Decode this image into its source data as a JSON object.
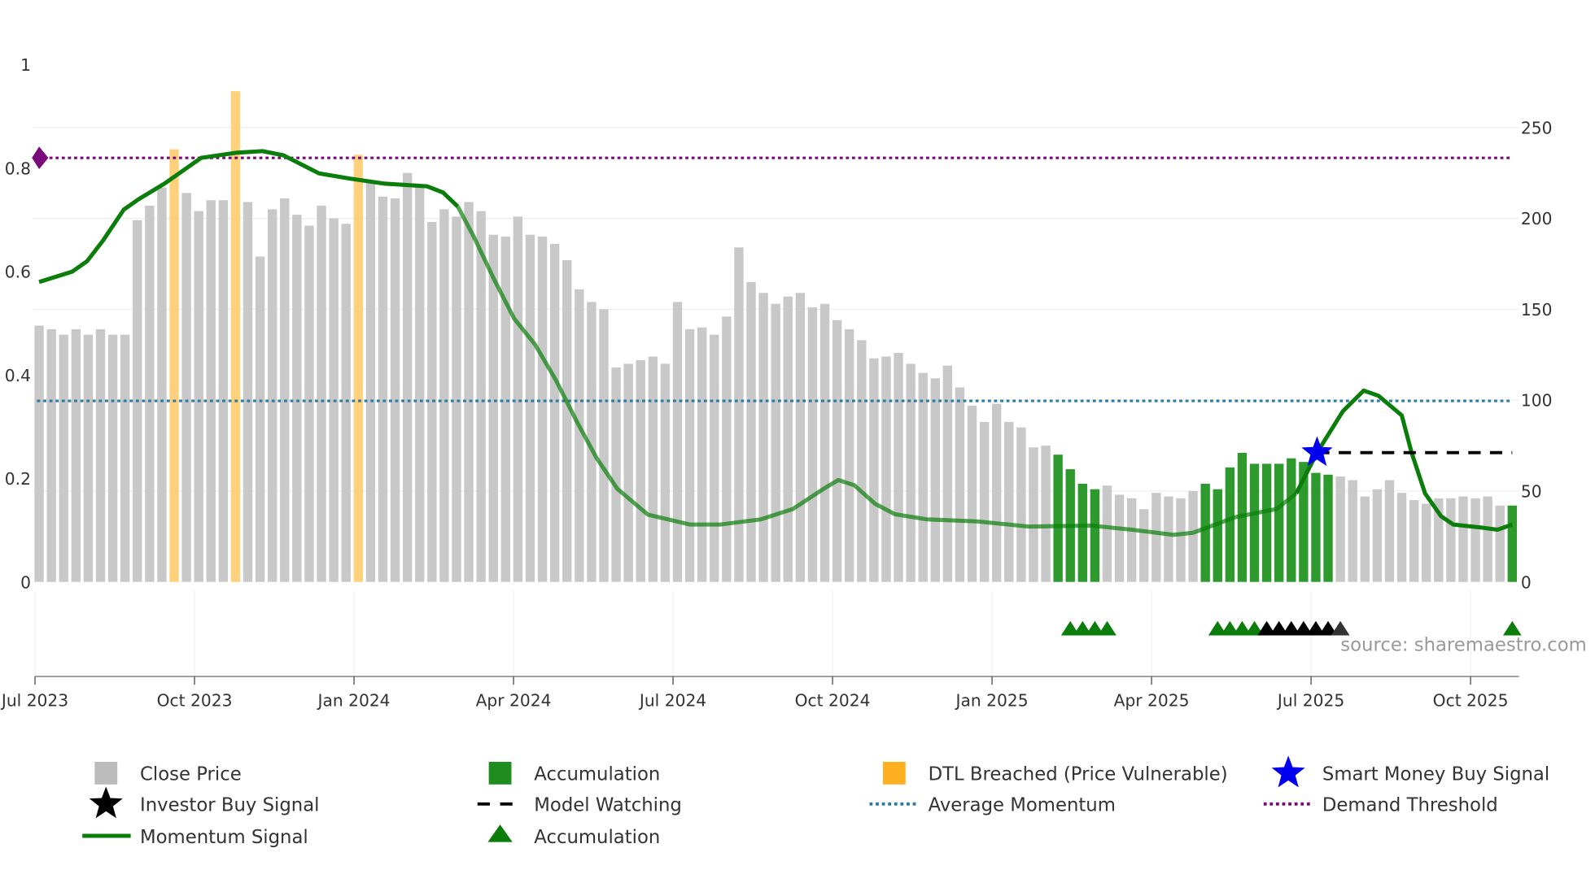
{
  "chart_data": {
    "type": "bar",
    "title": "",
    "x_unit": "weekly bars starting Jul 2023",
    "left_axis": {
      "range": [
        0,
        1
      ],
      "ticks": [
        "0",
        "0.2",
        "0.4",
        "0.6",
        "0.8",
        "1"
      ],
      "tick_values": [
        0,
        0.2,
        0.4,
        0.6,
        0.8,
        1
      ]
    },
    "right_axis": {
      "range": [
        0,
        284
      ],
      "ticks": [
        "0",
        "50",
        "100",
        "150",
        "200",
        "250"
      ],
      "tick_values": [
        0,
        50,
        100,
        150,
        200,
        250
      ]
    },
    "x_ticks": [
      {
        "label": "Jul 2023",
        "month": 0
      },
      {
        "label": "Oct 2023",
        "month": 3
      },
      {
        "label": "Jan 2024",
        "month": 6
      },
      {
        "label": "Apr 2024",
        "month": 9
      },
      {
        "label": "Jul 2024",
        "month": 12
      },
      {
        "label": "Oct 2024",
        "month": 15
      },
      {
        "label": "Jan 2025",
        "month": 18
      },
      {
        "label": "Apr 2025",
        "month": 21
      },
      {
        "label": "Jul 2025",
        "month": 24
      },
      {
        "label": "Oct 2025",
        "month": 27
      }
    ],
    "close_price": [
      141,
      139,
      136,
      139,
      136,
      139,
      136,
      136,
      199,
      207,
      217,
      238,
      214,
      204,
      210,
      210,
      270,
      209,
      179,
      205,
      211,
      202,
      196,
      207,
      200,
      197,
      235,
      221,
      212,
      211,
      225,
      217,
      198,
      205,
      201,
      209,
      204,
      191,
      190,
      201,
      191,
      190,
      186,
      177,
      161,
      154,
      150,
      118,
      120,
      122,
      124,
      120,
      154,
      139,
      140,
      136,
      146,
      184,
      165,
      159,
      153,
      157,
      159,
      151,
      153,
      144,
      139,
      133,
      123,
      124,
      126,
      120,
      115,
      112,
      119,
      107,
      97,
      88,
      98,
      88,
      85,
      74,
      75,
      70,
      62,
      54,
      51,
      53,
      48,
      46,
      40,
      49,
      47,
      46,
      50,
      54,
      51,
      63,
      71,
      65,
      65,
      65,
      68,
      66,
      60,
      59,
      58,
      56,
      47,
      51,
      56,
      49,
      45,
      43,
      46,
      46,
      47,
      46,
      47,
      42,
      42
    ],
    "bar_state": "n=normal, d=DTL breached, a=accumulation",
    "bar_states": "nnnnnnnnnnndnnnndnnnnnnnnndnnnnnnnnnnnnnnnnnnnnnnnnnnnnnnnnnnnnnnnnnnnnnnnnnnnnnnnnaaaannnnnnnnaaaaaaaaaaannnnnnnnnnnnnna",
    "momentum": [
      [
        0,
        0.58
      ],
      [
        2.7,
        0.6
      ],
      [
        3.9,
        0.62
      ],
      [
        5.2,
        0.66
      ],
      [
        6.9,
        0.72
      ],
      [
        8.1,
        0.74
      ],
      [
        10.2,
        0.77
      ],
      [
        13.2,
        0.82
      ],
      [
        16.1,
        0.83
      ],
      [
        18.2,
        0.833
      ],
      [
        19.9,
        0.825
      ],
      [
        22.8,
        0.79
      ],
      [
        25.3,
        0.78
      ],
      [
        28.2,
        0.77
      ],
      [
        31.6,
        0.765
      ],
      [
        32.9,
        0.753
      ],
      [
        34.1,
        0.726
      ],
      [
        35.4,
        0.668
      ],
      [
        37,
        0.588
      ],
      [
        38.7,
        0.509
      ],
      [
        40.4,
        0.459
      ],
      [
        42.1,
        0.39
      ],
      [
        43.8,
        0.31
      ],
      [
        45.4,
        0.24
      ],
      [
        47.1,
        0.18
      ],
      [
        49.6,
        0.13
      ],
      [
        53,
        0.111
      ],
      [
        55.5,
        0.111
      ],
      [
        58.8,
        0.121
      ],
      [
        61.4,
        0.141
      ],
      [
        63.9,
        0.18
      ],
      [
        65.1,
        0.197
      ],
      [
        66.4,
        0.187
      ],
      [
        68.1,
        0.151
      ],
      [
        69.7,
        0.131
      ],
      [
        72.3,
        0.121
      ],
      [
        76.4,
        0.117
      ],
      [
        80.6,
        0.107
      ],
      [
        85.7,
        0.109
      ],
      [
        89,
        0.101
      ],
      [
        92.4,
        0.091
      ],
      [
        94,
        0.095
      ],
      [
        97.4,
        0.125
      ],
      [
        100.8,
        0.141
      ],
      [
        102.4,
        0.171
      ],
      [
        104.1,
        0.25
      ],
      [
        106.2,
        0.33
      ],
      [
        107.9,
        0.37
      ],
      [
        109.1,
        0.36
      ],
      [
        111,
        0.322
      ],
      [
        111.8,
        0.25
      ],
      [
        112.9,
        0.171
      ],
      [
        114.2,
        0.127
      ],
      [
        115.2,
        0.111
      ],
      [
        117.5,
        0.105
      ],
      [
        118.8,
        0.101
      ],
      [
        120,
        0.111
      ]
    ],
    "average_momentum": 0.35,
    "demand_threshold": 0.82,
    "model_watching": {
      "from_week": 104.1,
      "to_week": 120,
      "value": 0.25
    },
    "smart_money_buy_signal": {
      "week": 104.1,
      "value": 0.25
    },
    "accumulation_markers": [
      84,
      85,
      86,
      87,
      96,
      97,
      98,
      99,
      120
    ],
    "investor_buy_markers": [
      100,
      101,
      102,
      103,
      104,
      105,
      106
    ],
    "colors": {
      "price": "#c8c8c8",
      "dtl": "#ffc966",
      "accumulation": "#2e9a2e",
      "momentum": "#0a7d0a",
      "avg": "#2a7aa8",
      "demand": "#7a0a7a",
      "star": "#0000ee"
    },
    "source": "source: sharemaestro.com",
    "legend": [
      {
        "label": "Close Price",
        "symbol": "grey-square"
      },
      {
        "label": "Accumulation",
        "symbol": "green-square"
      },
      {
        "label": "DTL Breached (Price Vulnerable)",
        "symbol": "orange-square"
      },
      {
        "label": "Smart Money Buy Signal",
        "symbol": "blue-star"
      },
      {
        "label": "Investor Buy Signal",
        "symbol": "black-star"
      },
      {
        "label": "Model Watching",
        "symbol": "black-dash"
      },
      {
        "label": "Average Momentum",
        "symbol": "blue-dot"
      },
      {
        "label": "Demand Threshold",
        "symbol": "purple-dot"
      },
      {
        "label": "Momentum Signal",
        "symbol": "green-line"
      },
      {
        "label": "Accumulation",
        "symbol": "green-triangle"
      }
    ]
  }
}
